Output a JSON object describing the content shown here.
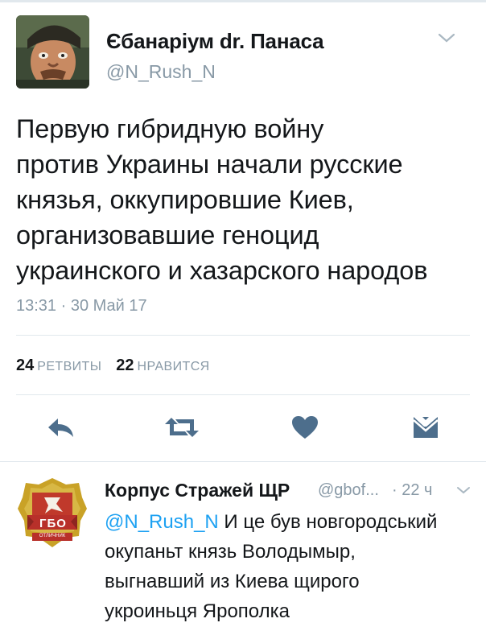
{
  "tweet": {
    "display_name": "Єбанаріум dr. Панаса",
    "handle": "@N_Rush_N",
    "text_lines": [
      "Первую гибридную войну",
      "против Украины начали русские",
      "князья, оккупировшие Киев,",
      "организовавшие геноцид",
      "украинского и хазарского народов"
    ],
    "timestamp": "13:31 · 30 Май 17",
    "retweets_count": "24",
    "retweets_label": "РЕТВИТЫ",
    "likes_count": "22",
    "likes_label": "НРАВИТСЯ",
    "icons": {
      "menu": "chevron-down-icon",
      "reply": "reply-icon",
      "retweet": "retweet-icon",
      "like": "heart-icon",
      "message": "envelope-icon"
    }
  },
  "reply": {
    "display_name": "Корпус Стражей ЩР",
    "handle": "@gbof...",
    "time": "· 22 ч",
    "mention": "@N_Rush_N",
    "text_first_rest": " И це був новгородський",
    "text_lines": [
      "окупаньт князь Володымыр,",
      "выгнавший из Киева щирого",
      "укроиньця Ярополка"
    ],
    "badge_text": "ГБО",
    "badge_subtext": "ОТЛИЧНИК"
  },
  "colors": {
    "text": "#14171a",
    "secondary": "#8899a6",
    "link": "#1da1f2",
    "icon": "#4d6e8c",
    "divider": "#e1e8ed"
  }
}
